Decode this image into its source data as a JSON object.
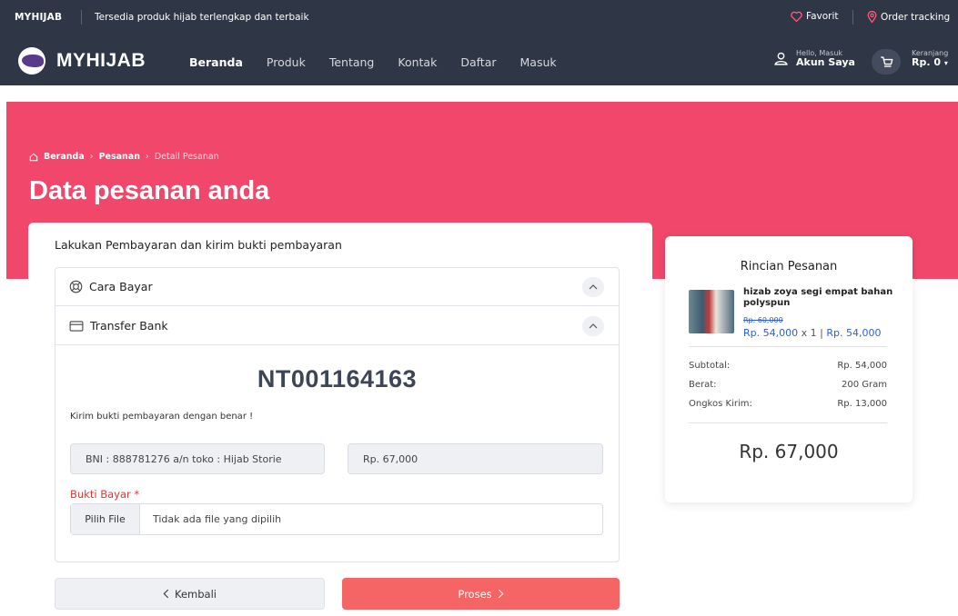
{
  "topbar": {
    "brand": "MYHIJAB",
    "tagline": "Tersedia produk hijab terlengkap dan terbaik",
    "favorit": "Favorit",
    "order_tracking": "Order tracking"
  },
  "navbar": {
    "logo_text": "MYHIJAB",
    "links": [
      {
        "label": "Beranda",
        "active": true
      },
      {
        "label": "Produk",
        "active": false
      },
      {
        "label": "Tentang",
        "active": false
      },
      {
        "label": "Kontak",
        "active": false
      },
      {
        "label": "Daftar",
        "active": false
      },
      {
        "label": "Masuk",
        "active": false
      }
    ],
    "account_greeting": "Hello, Masuk",
    "account_label": "Akun Saya",
    "cart_label": "Keranjang",
    "cart_total": "Rp. 0"
  },
  "hero": {
    "breadcrumb": {
      "home": "Beranda",
      "orders": "Pesanan",
      "current": "Detail Pesanan"
    },
    "title": "Data pesanan anda"
  },
  "payment": {
    "instruction": "Lakukan Pembayaran dan kirim bukti pembayaran",
    "accordion": {
      "how_to_pay": "Cara Bayar",
      "bank_transfer": "Transfer Bank"
    },
    "order_code": "NT001164163",
    "send_note": "Kirim bukti pembayaran dengan benar !",
    "bank_account": "BNI : 888781276 a/n toko : Hijab Storie",
    "amount": "Rp. 67,000",
    "proof_label": "Bukti Bayar *",
    "file_button": "Pilih File",
    "file_placeholder": "Tidak ada file yang dipilih",
    "back_button": "Kembali",
    "process_button": "Proses"
  },
  "summary": {
    "title": "Rincian Pesanan",
    "product": {
      "name": "hizab zoya segi empat bahan polyspun",
      "old_price": "Rp. 60,000",
      "price": "Rp. 54,000",
      "qty": "x 1",
      "line_total": "Rp. 54,000"
    },
    "rows": [
      {
        "label": "Subtotal:",
        "value": "Rp. 54,000"
      },
      {
        "label": "Berat:",
        "value": "200 Gram"
      },
      {
        "label": "Ongkos Kirim:",
        "value": "Rp. 13,000"
      }
    ],
    "total": "Rp. 67,000"
  },
  "colors": {
    "nav_bg": "#2f3645",
    "hero_bg": "#f0476a",
    "accent_red": "#f56565",
    "link_blue": "#2d5fd6"
  },
  "icons": [
    "heart-icon",
    "location-pin-icon",
    "logo-icon",
    "user-icon",
    "cart-icon",
    "caret-down-icon",
    "home-icon",
    "lifebuoy-icon",
    "credit-card-icon",
    "chevron-up-icon",
    "chevron-left-icon",
    "chevron-right-icon"
  ]
}
